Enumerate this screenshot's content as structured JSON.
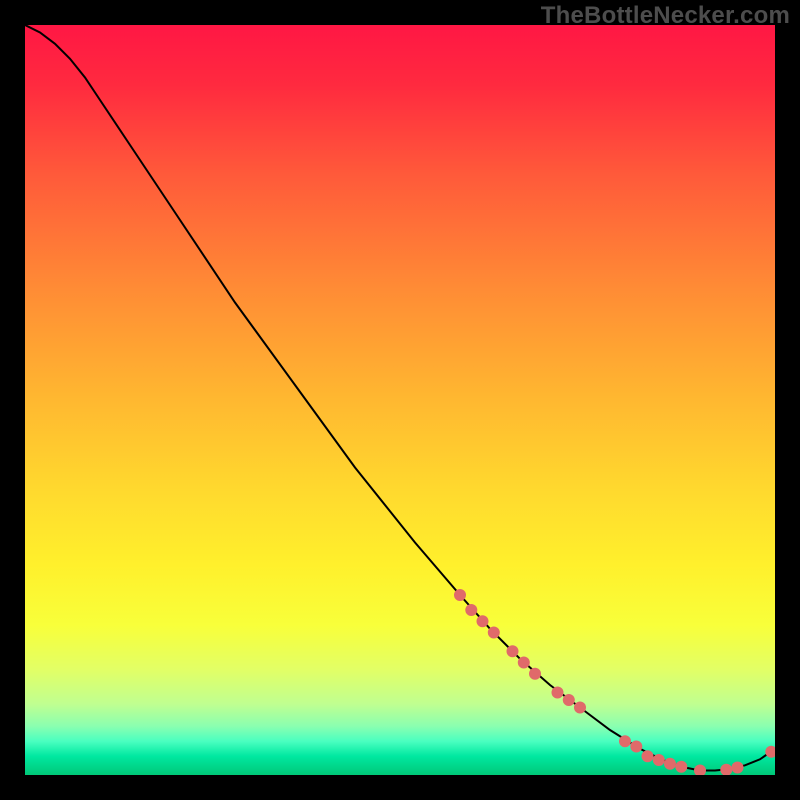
{
  "watermark": "TheBottleNecker.com",
  "chart_data": {
    "type": "line",
    "title": "",
    "xlabel": "",
    "ylabel": "",
    "xlim": [
      0,
      100
    ],
    "ylim": [
      0,
      100
    ],
    "background_gradient": {
      "stops": [
        {
          "offset": 0.0,
          "color": "#ff1744"
        },
        {
          "offset": 0.08,
          "color": "#ff2a3f"
        },
        {
          "offset": 0.2,
          "color": "#ff5a3a"
        },
        {
          "offset": 0.35,
          "color": "#ff8b35"
        },
        {
          "offset": 0.5,
          "color": "#ffb830"
        },
        {
          "offset": 0.62,
          "color": "#ffd92e"
        },
        {
          "offset": 0.72,
          "color": "#fff02c"
        },
        {
          "offset": 0.8,
          "color": "#f8ff3a"
        },
        {
          "offset": 0.86,
          "color": "#e2ff66"
        },
        {
          "offset": 0.905,
          "color": "#c0ff90"
        },
        {
          "offset": 0.935,
          "color": "#8affb0"
        },
        {
          "offset": 0.955,
          "color": "#4affc0"
        },
        {
          "offset": 0.975,
          "color": "#00e8a0"
        },
        {
          "offset": 1.0,
          "color": "#00c878"
        }
      ]
    },
    "series": [
      {
        "name": "bottleneck-curve",
        "color": "#000000",
        "x": [
          0.0,
          2.0,
          4.0,
          6.0,
          8.0,
          10.0,
          14.0,
          20.0,
          28.0,
          36.0,
          44.0,
          52.0,
          58.0,
          62.0,
          66.0,
          70.0,
          74.0,
          78.0,
          82.0,
          85.0,
          88.0,
          90.0,
          92.0,
          94.0,
          96.0,
          98.0,
          100.0
        ],
        "y": [
          100.0,
          99.0,
          97.5,
          95.5,
          93.0,
          90.0,
          84.0,
          75.0,
          63.0,
          52.0,
          41.0,
          31.0,
          24.0,
          19.5,
          15.5,
          12.0,
          9.0,
          6.0,
          3.5,
          2.0,
          1.0,
          0.6,
          0.6,
          0.8,
          1.3,
          2.1,
          3.5
        ]
      }
    ],
    "markers": {
      "name": "highlight-points",
      "color": "#e06a6a",
      "radius": 6,
      "points": [
        {
          "x": 58.0,
          "y": 24.0
        },
        {
          "x": 59.5,
          "y": 22.0
        },
        {
          "x": 61.0,
          "y": 20.5
        },
        {
          "x": 62.5,
          "y": 19.0
        },
        {
          "x": 65.0,
          "y": 16.5
        },
        {
          "x": 66.5,
          "y": 15.0
        },
        {
          "x": 68.0,
          "y": 13.5
        },
        {
          "x": 71.0,
          "y": 11.0
        },
        {
          "x": 72.5,
          "y": 10.0
        },
        {
          "x": 74.0,
          "y": 9.0
        },
        {
          "x": 80.0,
          "y": 4.5
        },
        {
          "x": 81.5,
          "y": 3.8
        },
        {
          "x": 83.0,
          "y": 2.5
        },
        {
          "x": 84.5,
          "y": 2.0
        },
        {
          "x": 86.0,
          "y": 1.5
        },
        {
          "x": 87.5,
          "y": 1.1
        },
        {
          "x": 90.0,
          "y": 0.6
        },
        {
          "x": 93.5,
          "y": 0.7
        },
        {
          "x": 95.0,
          "y": 1.0
        },
        {
          "x": 99.5,
          "y": 3.1
        }
      ]
    }
  }
}
